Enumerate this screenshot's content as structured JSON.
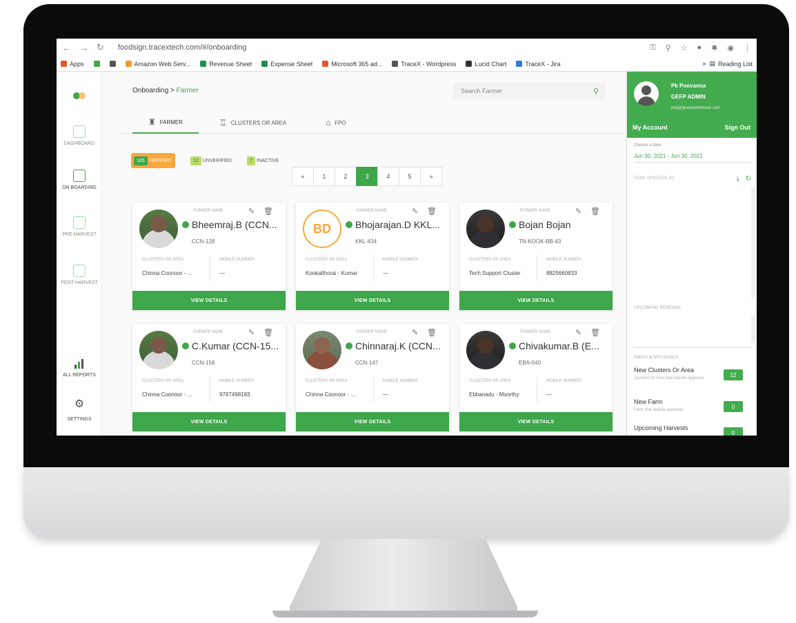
{
  "browser": {
    "url": "foodsign.tracextech.com/#/onboarding",
    "bookmarks": [
      {
        "label": "Apps",
        "color": "#e4572e"
      },
      {
        "label": "",
        "color": "#3ea64b"
      },
      {
        "label": "",
        "color": "#555555"
      },
      {
        "label": "Amazon Web Serv...",
        "color": "#f29a2e"
      },
      {
        "label": "Revenue Sheet",
        "color": "#1d8f4e"
      },
      {
        "label": "Expense Sheet",
        "color": "#1d8f4e"
      },
      {
        "label": "Microsoft 365 ad...",
        "color": "#e4572e"
      },
      {
        "label": "TraceX - Wordpress",
        "color": "#555555"
      },
      {
        "label": "Lucid Chart",
        "color": "#333333"
      },
      {
        "label": "TraceX - Jira",
        "color": "#2a7be4"
      }
    ],
    "reading_list": "Reading List"
  },
  "sidebar": {
    "items": [
      {
        "label": "DASHBOARD",
        "active": false
      },
      {
        "label": "ON BOARDING",
        "active": true
      },
      {
        "label": "PRE HARVEST",
        "active": false
      },
      {
        "label": "POST HARVEST",
        "active": false
      },
      {
        "label": "ALL REPORTS",
        "active": true
      },
      {
        "label": "SETTINGS",
        "active": true
      }
    ]
  },
  "breadcrumb": {
    "root": "Onboarding",
    "sep": ">",
    "current": "Farmer"
  },
  "search": {
    "placeholder": "Search Farmer"
  },
  "tabs": [
    {
      "label": "FARMER",
      "active": true
    },
    {
      "label": "CLUSTERS OR AREA",
      "active": false
    },
    {
      "label": "FPO",
      "active": false
    }
  ],
  "filters": [
    {
      "count": "165",
      "label": "VERIFIED"
    },
    {
      "count": "12",
      "label": "UNVERIFIED"
    },
    {
      "count": "7",
      "label": "INACTIVE"
    }
  ],
  "pagination": {
    "pages": [
      "«",
      "1",
      "2",
      "3",
      "4",
      "5",
      "»"
    ],
    "current": "3"
  },
  "card_labels": {
    "farmer_name": "FARMER NAME",
    "clusters": "CLUSTERS OR AREA",
    "mobile": "MOBILE NUMBER",
    "view": "VIEW DETAILS"
  },
  "farmers": [
    {
      "name": "Bheemraj.B (CCN...",
      "id": "CCN-128",
      "cluster": "Chinna Coonoor - ...",
      "mobile": "—",
      "avatar": "photo"
    },
    {
      "name": "Bhojarajan.D KKL...",
      "id": "KKL-434",
      "cluster": "Kookalthorai - Kumar",
      "mobile": "—",
      "avatar": "initials",
      "initials": "BD"
    },
    {
      "name": "Bojan Bojan",
      "id": "TN-KOOK-BB-43",
      "cluster": "Tech Support Cluster",
      "mobile": "8825660833",
      "avatar": "photo b"
    },
    {
      "name": "C.Kumar (CCN-15...",
      "id": "CCN-158",
      "cluster": "Chinna Coonoor - ...",
      "mobile": "9787498183",
      "avatar": "photo"
    },
    {
      "name": "Chinnaraj.K (CCN...",
      "id": "CCN-147",
      "cluster": "Chinna Coonoor - ...",
      "mobile": "—",
      "avatar": "photo c"
    },
    {
      "name": "Chivakumar.B (E...",
      "id": "EBA-040",
      "cluster": "Ebbanadu - Moorthy",
      "mobile": "—",
      "avatar": "photo b"
    }
  ],
  "account": {
    "name": "Pk Poovanna",
    "role": "GEFP ADMIN",
    "email": "pkp@greenearthfresh.com",
    "my_account": "My Account",
    "sign_out": "Sign Out",
    "date_label": "Choose a date",
    "date_range": "Jun 30, 2021 - Jun 30, 2021",
    "task_updates": "TASK UPDATES (0)",
    "upcoming_renewal": "UPCOMING RENEWAL",
    "inbox": "INBOX & MESSAGES",
    "messages": [
      {
        "title": "New Clusters Or Area",
        "sub": "Clusters Or Area that require approval",
        "count": "12"
      },
      {
        "title": "New Farm",
        "sub": "Farm that require approval",
        "count": "0"
      },
      {
        "title": "Upcoming Harvests",
        "sub": "",
        "count": "0"
      }
    ]
  },
  "colors": {
    "accent": "#3ea64b",
    "verified": "#f7a83b"
  }
}
